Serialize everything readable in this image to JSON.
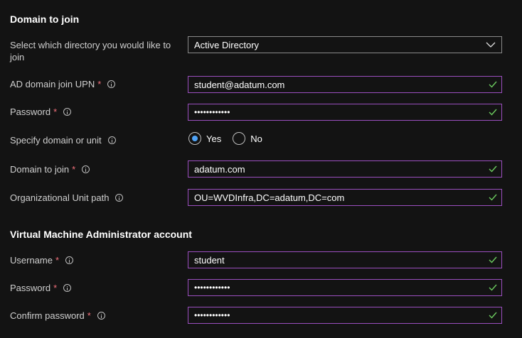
{
  "domain_section": {
    "title": "Domain to join",
    "directory": {
      "label": "Select which directory you would like to join",
      "value": "Active Directory"
    },
    "upn": {
      "label": "AD domain join UPN",
      "required": "*",
      "value": "student@adatum.com"
    },
    "password": {
      "label": "Password",
      "required": "*",
      "value": "••••••••••••"
    },
    "specify_domain": {
      "label": "Specify domain or unit",
      "yes_label": "Yes",
      "no_label": "No",
      "selected": "Yes"
    },
    "domain_to_join": {
      "label": "Domain to join",
      "required": "*",
      "value": "adatum.com"
    },
    "ou_path": {
      "label": "Organizational Unit path",
      "value": "OU=WVDInfra,DC=adatum,DC=com"
    }
  },
  "vm_admin_section": {
    "title": "Virtual Machine Administrator account",
    "username": {
      "label": "Username",
      "required": "*",
      "value": "student"
    },
    "password": {
      "label": "Password",
      "required": "*",
      "value": "••••••••••••"
    },
    "confirm_password": {
      "label": "Confirm password",
      "required": "*",
      "value": "••••••••••••"
    }
  },
  "colors": {
    "field_border_valid": "#9b4fbf",
    "check_green": "#6ccb5f",
    "required_red": "#f1707b",
    "radio_blue": "#4fa3f7"
  }
}
